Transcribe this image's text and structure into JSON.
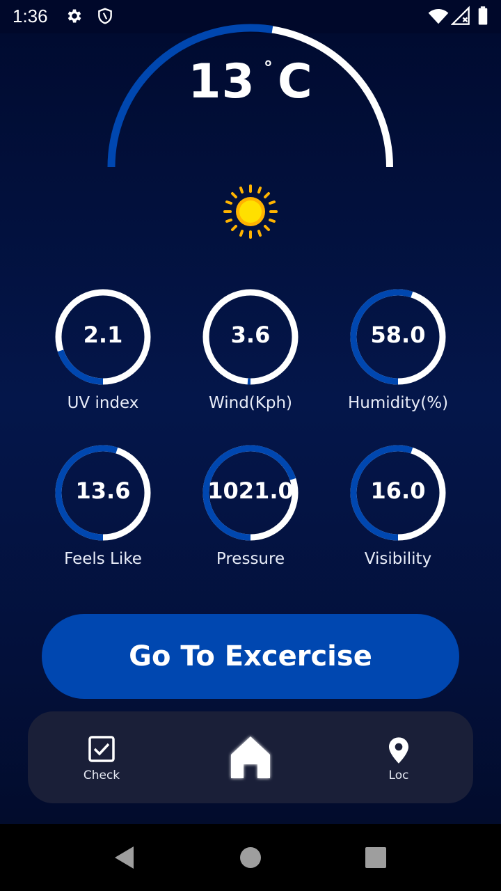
{
  "status_bar": {
    "time": "1:36",
    "icons": [
      "gear-icon",
      "shield-icon",
      "wifi-icon",
      "signal-icon",
      "battery-icon"
    ]
  },
  "weather": {
    "temperature": "13",
    "degree_symbol": "°",
    "unit": "C",
    "gauge_fill_fraction": 0.55,
    "condition_icon": "sun-icon"
  },
  "metrics": [
    {
      "value": "2.1",
      "label": "UV index",
      "fill_fraction": 0.2
    },
    {
      "value": "3.6",
      "label": "Wind(Kph)",
      "fill_fraction": 0.01
    },
    {
      "value": "58.0",
      "label": "Humidity(%)",
      "fill_fraction": 0.55
    },
    {
      "value": "13.6",
      "label": "Feels Like",
      "fill_fraction": 0.55
    },
    {
      "value": "1021.0",
      "label": "Pressure",
      "fill_fraction": 0.7
    },
    {
      "value": "16.0",
      "label": "Visibility",
      "fill_fraction": 0.55
    }
  ],
  "cta": {
    "label": "Go To Excercise"
  },
  "bottom_nav": {
    "items": [
      {
        "label": "Check",
        "icon": "checkbox-icon"
      },
      {
        "label": "",
        "icon": "home-icon"
      },
      {
        "label": "Loc",
        "icon": "location-pin-icon"
      }
    ]
  },
  "system_nav": {
    "icons": [
      "back-icon",
      "home-circle-icon",
      "recents-icon"
    ]
  },
  "colors": {
    "accent": "#0047b0",
    "background": "#03103a",
    "nav_bg": "#1a1f38",
    "ring_track": "#ffffff",
    "sun": "#ffc400"
  }
}
